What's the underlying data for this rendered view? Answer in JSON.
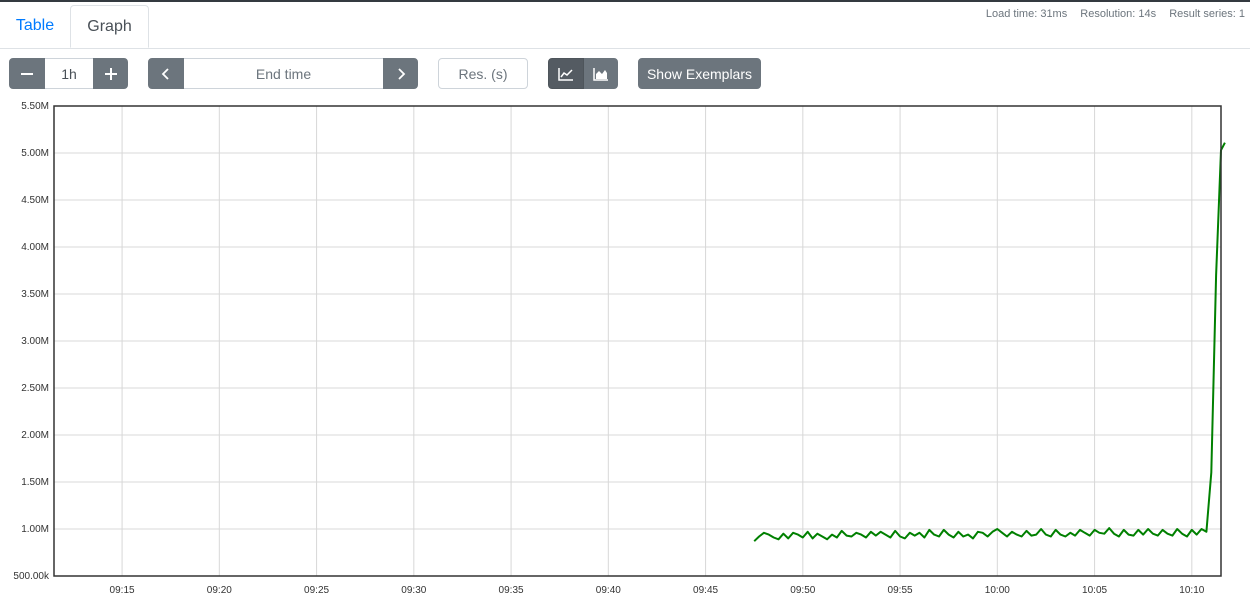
{
  "tabs": [
    {
      "label": "Table",
      "active": false
    },
    {
      "label": "Graph",
      "active": true
    }
  ],
  "stats": {
    "load_time": "Load time: 31ms",
    "resolution": "Resolution: 14s",
    "result_series": "Result series: 1"
  },
  "controls": {
    "range_value": "1h",
    "end_time_placeholder": "End time",
    "resolution_placeholder": "Res. (s)",
    "show_exemplars_label": "Show Exemplars"
  },
  "icons": {
    "minus": "minus-icon",
    "plus": "plus-icon",
    "prev": "chevron-left-icon",
    "next": "chevron-right-icon",
    "line": "line-chart-icon",
    "stacked": "area-chart-icon"
  },
  "colors": {
    "series": "#008000",
    "button": "#6c757d",
    "button_active": "#545b62",
    "tab_active_text": "#495057",
    "tab_link": "#007bff"
  },
  "chart_data": {
    "type": "line",
    "y_ticks": [
      "500.00k",
      "1.00M",
      "1.50M",
      "2.00M",
      "2.50M",
      "3.00M",
      "3.50M",
      "4.00M",
      "4.50M",
      "5.00M",
      "5.50M"
    ],
    "ylim": [
      500000,
      5500000
    ],
    "x_ticks": [
      "09:15",
      "09:20",
      "09:25",
      "09:30",
      "09:35",
      "09:40",
      "09:45",
      "09:50",
      "09:55",
      "10:00",
      "10:05",
      "10:10"
    ],
    "x_tick_minutes": [
      15,
      20,
      25,
      30,
      35,
      40,
      45,
      50,
      55,
      60,
      65,
      70
    ],
    "xlim_minutes": [
      11.5,
      71.5
    ],
    "grid": true,
    "series": [
      {
        "color": "#008000",
        "points": [
          [
            47.5,
            870000
          ],
          [
            47.75,
            920000
          ],
          [
            48.0,
            960000
          ],
          [
            48.25,
            940000
          ],
          [
            48.5,
            910000
          ],
          [
            48.75,
            890000
          ],
          [
            49.0,
            950000
          ],
          [
            49.25,
            900000
          ],
          [
            49.5,
            960000
          ],
          [
            49.75,
            940000
          ],
          [
            50.0,
            910000
          ],
          [
            50.25,
            970000
          ],
          [
            50.5,
            900000
          ],
          [
            50.75,
            950000
          ],
          [
            51.0,
            920000
          ],
          [
            51.25,
            890000
          ],
          [
            51.5,
            940000
          ],
          [
            51.75,
            910000
          ],
          [
            52.0,
            980000
          ],
          [
            52.25,
            930000
          ],
          [
            52.5,
            920000
          ],
          [
            52.75,
            960000
          ],
          [
            53.0,
            940000
          ],
          [
            53.25,
            910000
          ],
          [
            53.5,
            970000
          ],
          [
            53.75,
            930000
          ],
          [
            54.0,
            970000
          ],
          [
            54.25,
            940000
          ],
          [
            54.5,
            910000
          ],
          [
            54.75,
            980000
          ],
          [
            55.0,
            920000
          ],
          [
            55.25,
            900000
          ],
          [
            55.5,
            960000
          ],
          [
            55.75,
            930000
          ],
          [
            56.0,
            960000
          ],
          [
            56.25,
            910000
          ],
          [
            56.5,
            990000
          ],
          [
            56.75,
            940000
          ],
          [
            57.0,
            920000
          ],
          [
            57.25,
            990000
          ],
          [
            57.5,
            940000
          ],
          [
            57.75,
            910000
          ],
          [
            58.0,
            970000
          ],
          [
            58.25,
            920000
          ],
          [
            58.5,
            940000
          ],
          [
            58.75,
            900000
          ],
          [
            59.0,
            970000
          ],
          [
            59.25,
            960000
          ],
          [
            59.5,
            920000
          ],
          [
            59.75,
            970000
          ],
          [
            60.0,
            1000000
          ],
          [
            60.25,
            960000
          ],
          [
            60.5,
            920000
          ],
          [
            60.75,
            970000
          ],
          [
            61.0,
            940000
          ],
          [
            61.25,
            920000
          ],
          [
            61.5,
            980000
          ],
          [
            61.75,
            930000
          ],
          [
            62.0,
            940000
          ],
          [
            62.25,
            1000000
          ],
          [
            62.5,
            940000
          ],
          [
            62.75,
            920000
          ],
          [
            63.0,
            990000
          ],
          [
            63.25,
            940000
          ],
          [
            63.5,
            920000
          ],
          [
            63.75,
            960000
          ],
          [
            64.0,
            930000
          ],
          [
            64.25,
            990000
          ],
          [
            64.5,
            960000
          ],
          [
            64.75,
            930000
          ],
          [
            65.0,
            990000
          ],
          [
            65.25,
            960000
          ],
          [
            65.5,
            950000
          ],
          [
            65.75,
            1010000
          ],
          [
            66.0,
            950000
          ],
          [
            66.25,
            920000
          ],
          [
            66.5,
            990000
          ],
          [
            66.75,
            940000
          ],
          [
            67.0,
            930000
          ],
          [
            67.25,
            990000
          ],
          [
            67.5,
            940000
          ],
          [
            67.75,
            1000000
          ],
          [
            68.0,
            950000
          ],
          [
            68.25,
            930000
          ],
          [
            68.5,
            990000
          ],
          [
            68.75,
            950000
          ],
          [
            69.0,
            930000
          ],
          [
            69.25,
            1000000
          ],
          [
            69.5,
            950000
          ],
          [
            69.75,
            920000
          ],
          [
            70.0,
            990000
          ],
          [
            70.25,
            940000
          ],
          [
            70.5,
            1000000
          ],
          [
            70.75,
            970000
          ],
          [
            71.0,
            1600000
          ],
          [
            71.25,
            3700000
          ],
          [
            71.5,
            5030000
          ],
          [
            71.7,
            5110000
          ]
        ]
      }
    ]
  }
}
